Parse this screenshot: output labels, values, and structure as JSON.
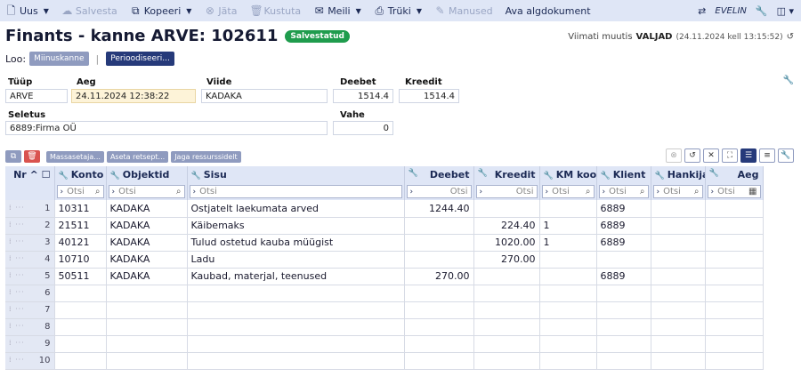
{
  "toolbar": {
    "new": "Uus",
    "save": "Salvesta",
    "copy": "Kopeeri",
    "cancel": "Jäta",
    "delete": "Kustuta",
    "mail": "Meili",
    "print": "Trüki",
    "attachments": "Manused",
    "open_source": "Ava algdokument",
    "user": "EVELIN"
  },
  "title": {
    "text": "Finants - kanne ARVE: 102611",
    "status": "Salvestatud",
    "modified_label": "Viimati muutis",
    "modified_by": "VALJAD",
    "modified_time": "(24.11.2024 kell 13:15:52)"
  },
  "loo": {
    "label": "Loo:",
    "btn_minus": "Miinuskanne",
    "btn_period": "Perioodiseeri..."
  },
  "header": {
    "tuup_label": "Tüüp",
    "tuup": "ARVE",
    "aeg_label": "Aeg",
    "aeg": "24.11.2024 12:38:22",
    "viide_label": "Viide",
    "viide": "KADAKA",
    "deebet_label": "Deebet",
    "deebet": "1514.4",
    "kreedit_label": "Kreedit",
    "kreedit": "1514.4",
    "seletus_label": "Seletus",
    "seletus": "6889:Firma OÜ",
    "vahe_label": "Vahe",
    "vahe": "0"
  },
  "grid_toolbar": {
    "mass": "Massasetaja...",
    "recipe": "Aseta retsept...",
    "share": "Jaga ressurssidelt"
  },
  "columns": {
    "nr": "Nr",
    "konto": "Konto",
    "objektid": "Objektid",
    "sisu": "Sisu",
    "deebet": "Deebet",
    "kreedit": "Kreedit",
    "km": "KM kood",
    "klient": "Klient",
    "hankija": "Hankija",
    "aeg": "Aeg"
  },
  "filter_placeholder": "Otsi",
  "rows": [
    {
      "nr": "1",
      "konto": "10311",
      "objektid": "KADAKA",
      "sisu": "Ostjatelt laekumata arved",
      "deebet": "1244.40",
      "kreedit": "",
      "km": "",
      "klient": "6889"
    },
    {
      "nr": "2",
      "konto": "21511",
      "objektid": "KADAKA",
      "sisu": "Käibemaks",
      "deebet": "",
      "kreedit": "224.40",
      "km": "1",
      "klient": "6889"
    },
    {
      "nr": "3",
      "konto": "40121",
      "objektid": "KADAKA",
      "sisu": "Tulud ostetud kauba müügist",
      "deebet": "",
      "kreedit": "1020.00",
      "km": "1",
      "klient": "6889"
    },
    {
      "nr": "4",
      "konto": "10710",
      "objektid": "KADAKA",
      "sisu": "Ladu",
      "deebet": "",
      "kreedit": "270.00",
      "km": "",
      "klient": ""
    },
    {
      "nr": "5",
      "konto": "50511",
      "objektid": "KADAKA",
      "sisu": "Kaubad, materjal, teenused",
      "deebet": "270.00",
      "kreedit": "",
      "km": "",
      "klient": "6889"
    },
    {
      "nr": "6",
      "konto": "",
      "objektid": "",
      "sisu": "",
      "deebet": "",
      "kreedit": "",
      "km": "",
      "klient": ""
    },
    {
      "nr": "7",
      "konto": "",
      "objektid": "",
      "sisu": "",
      "deebet": "",
      "kreedit": "",
      "km": "",
      "klient": ""
    },
    {
      "nr": "8",
      "konto": "",
      "objektid": "",
      "sisu": "",
      "deebet": "",
      "kreedit": "",
      "km": "",
      "klient": ""
    },
    {
      "nr": "9",
      "konto": "",
      "objektid": "",
      "sisu": "",
      "deebet": "",
      "kreedit": "",
      "km": "",
      "klient": ""
    },
    {
      "nr": "10",
      "konto": "",
      "objektid": "",
      "sisu": "",
      "deebet": "",
      "kreedit": "",
      "km": "",
      "klient": ""
    }
  ]
}
